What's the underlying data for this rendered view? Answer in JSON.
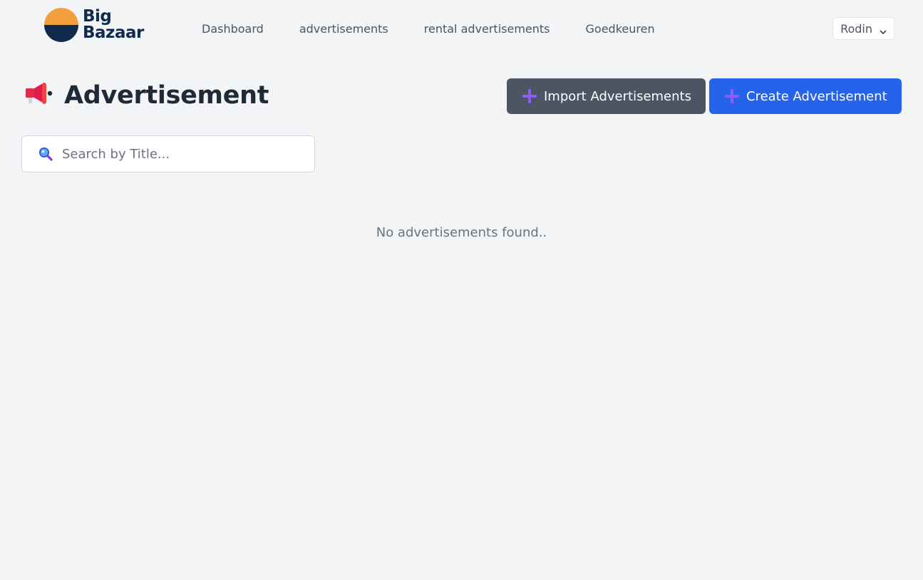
{
  "brand": {
    "line1": "Big",
    "line2": "Bazaar",
    "colors": {
      "orange": "#f2a03d",
      "navy": "#0f2a4d"
    }
  },
  "nav": {
    "items": [
      {
        "label": "Dashboard"
      },
      {
        "label": "advertisements"
      },
      {
        "label": "rental advertisements"
      },
      {
        "label": "Goedkeuren"
      }
    ]
  },
  "user": {
    "name": "Rodin",
    "icon": "chevron-down-icon"
  },
  "page": {
    "title": "Advertisement",
    "icon": "megaphone-icon"
  },
  "actions": {
    "import_label": "Import Advertisements",
    "create_label": "Create Advertisement",
    "import_color": "#4b5563",
    "create_color": "#2563eb",
    "icon": "plus-icon"
  },
  "search": {
    "placeholder": "Search by Title...",
    "value": "",
    "icon": "magnifier-icon"
  },
  "empty_state": {
    "message": "No advertisements found.."
  }
}
